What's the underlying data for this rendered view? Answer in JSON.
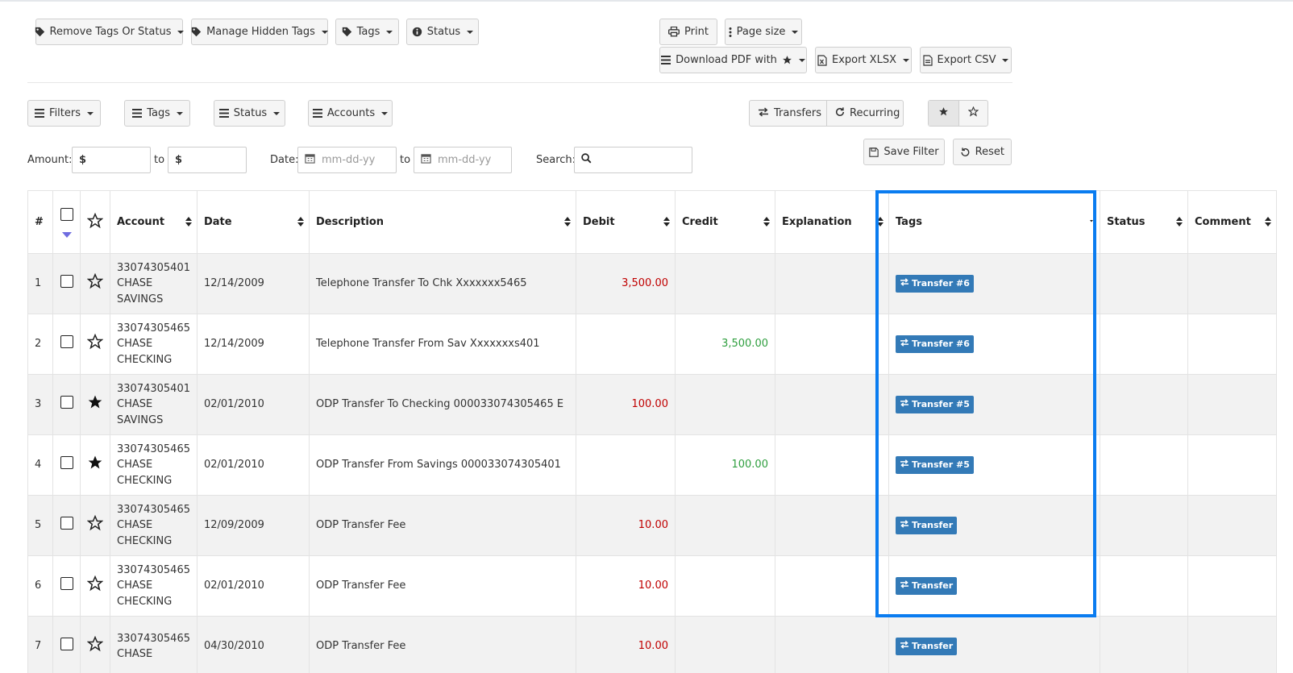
{
  "toolbar_top": {
    "remove_tags": "Remove Tags Or Status",
    "manage_hidden": "Manage Hidden Tags",
    "tags": "Tags",
    "status": "Status",
    "print": "Print",
    "page_size": "Page size",
    "download_pdf": "Download PDF with",
    "export_xlsx": "Export XLSX",
    "export_csv": "Export CSV"
  },
  "toolbar_filters": {
    "filters": "Filters",
    "tags": "Tags",
    "status": "Status",
    "accounts": "Accounts",
    "transfers": "Transfers",
    "recurring": "Recurring",
    "save_filter": "Save Filter",
    "reset": "Reset"
  },
  "search_row": {
    "amount_label": "Amount:",
    "to_label": "to",
    "date_label": "Date:",
    "search_label": "Search:",
    "currency": "$",
    "date_placeholder": "mm-dd-yy"
  },
  "table": {
    "headers": {
      "num": "#",
      "account": "Account",
      "date": "Date",
      "description": "Description",
      "debit": "Debit",
      "credit": "Credit",
      "explanation": "Explanation",
      "tags": "Tags",
      "status": "Status",
      "comment": "Comment"
    },
    "rows": [
      {
        "num": "1",
        "account": "33074305401 CHASE SAVINGS",
        "date": "12/14/2009",
        "description": "Telephone Transfer To Chk Xxxxxxx5465",
        "debit": "3,500.00",
        "credit": "",
        "tag": "Transfer #6",
        "starred": false
      },
      {
        "num": "2",
        "account": "33074305465 CHASE CHECKING",
        "date": "12/14/2009",
        "description": "Telephone Transfer From Sav Xxxxxxxs401",
        "debit": "",
        "credit": "3,500.00",
        "tag": "Transfer #6",
        "starred": false
      },
      {
        "num": "3",
        "account": "33074305401 CHASE SAVINGS",
        "date": "02/01/2010",
        "description": "ODP Transfer To Checking 000033074305465 E",
        "debit": "100.00",
        "credit": "",
        "tag": "Transfer #5",
        "starred": true
      },
      {
        "num": "4",
        "account": "33074305465 CHASE CHECKING",
        "date": "02/01/2010",
        "description": "ODP Transfer From Savings 000033074305401",
        "debit": "",
        "credit": "100.00",
        "tag": "Transfer #5",
        "starred": true
      },
      {
        "num": "5",
        "account": "33074305465 CHASE CHECKING",
        "date": "12/09/2009",
        "description": "ODP Transfer Fee",
        "debit": "10.00",
        "credit": "",
        "tag": "Transfer",
        "starred": false
      },
      {
        "num": "6",
        "account": "33074305465 CHASE CHECKING",
        "date": "02/01/2010",
        "description": "ODP Transfer Fee",
        "debit": "10.00",
        "credit": "",
        "tag": "Transfer",
        "starred": false
      },
      {
        "num": "7",
        "account": "33074305465 CHASE",
        "date": "04/30/2010",
        "description": "ODP Transfer Fee",
        "debit": "10.00",
        "credit": "",
        "tag": "Transfer",
        "starred": false
      }
    ]
  },
  "colors": {
    "tag_bg": "#337ab7",
    "highlight": "#0a7cf0",
    "debit": "#c00000",
    "credit": "#2e9e3e"
  }
}
